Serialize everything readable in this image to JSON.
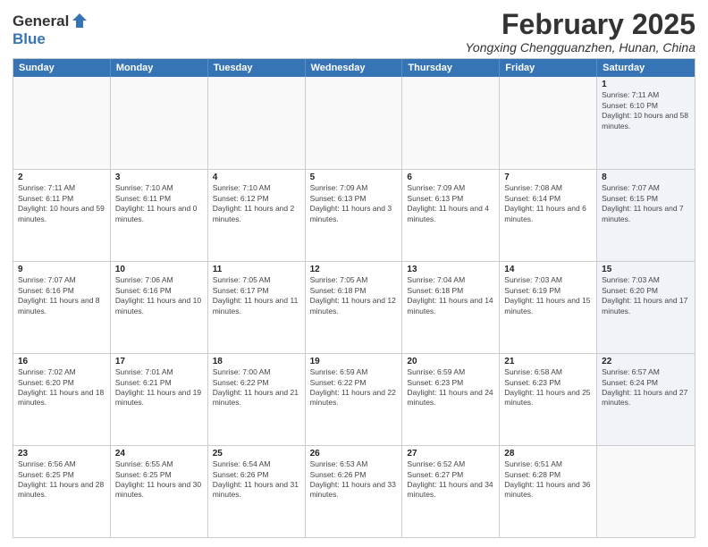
{
  "logo": {
    "general": "General",
    "blue": "Blue"
  },
  "title": "February 2025",
  "location": "Yongxing Chengguanzhen, Hunan, China",
  "weekdays": [
    "Sunday",
    "Monday",
    "Tuesday",
    "Wednesday",
    "Thursday",
    "Friday",
    "Saturday"
  ],
  "rows": [
    [
      {
        "day": "",
        "detail": ""
      },
      {
        "day": "",
        "detail": ""
      },
      {
        "day": "",
        "detail": ""
      },
      {
        "day": "",
        "detail": ""
      },
      {
        "day": "",
        "detail": ""
      },
      {
        "day": "",
        "detail": ""
      },
      {
        "day": "1",
        "detail": "Sunrise: 7:11 AM\nSunset: 6:10 PM\nDaylight: 10 hours and 58 minutes."
      }
    ],
    [
      {
        "day": "2",
        "detail": "Sunrise: 7:11 AM\nSunset: 6:11 PM\nDaylight: 10 hours and 59 minutes."
      },
      {
        "day": "3",
        "detail": "Sunrise: 7:10 AM\nSunset: 6:11 PM\nDaylight: 11 hours and 0 minutes."
      },
      {
        "day": "4",
        "detail": "Sunrise: 7:10 AM\nSunset: 6:12 PM\nDaylight: 11 hours and 2 minutes."
      },
      {
        "day": "5",
        "detail": "Sunrise: 7:09 AM\nSunset: 6:13 PM\nDaylight: 11 hours and 3 minutes."
      },
      {
        "day": "6",
        "detail": "Sunrise: 7:09 AM\nSunset: 6:13 PM\nDaylight: 11 hours and 4 minutes."
      },
      {
        "day": "7",
        "detail": "Sunrise: 7:08 AM\nSunset: 6:14 PM\nDaylight: 11 hours and 6 minutes."
      },
      {
        "day": "8",
        "detail": "Sunrise: 7:07 AM\nSunset: 6:15 PM\nDaylight: 11 hours and 7 minutes."
      }
    ],
    [
      {
        "day": "9",
        "detail": "Sunrise: 7:07 AM\nSunset: 6:16 PM\nDaylight: 11 hours and 8 minutes."
      },
      {
        "day": "10",
        "detail": "Sunrise: 7:06 AM\nSunset: 6:16 PM\nDaylight: 11 hours and 10 minutes."
      },
      {
        "day": "11",
        "detail": "Sunrise: 7:05 AM\nSunset: 6:17 PM\nDaylight: 11 hours and 11 minutes."
      },
      {
        "day": "12",
        "detail": "Sunrise: 7:05 AM\nSunset: 6:18 PM\nDaylight: 11 hours and 12 minutes."
      },
      {
        "day": "13",
        "detail": "Sunrise: 7:04 AM\nSunset: 6:18 PM\nDaylight: 11 hours and 14 minutes."
      },
      {
        "day": "14",
        "detail": "Sunrise: 7:03 AM\nSunset: 6:19 PM\nDaylight: 11 hours and 15 minutes."
      },
      {
        "day": "15",
        "detail": "Sunrise: 7:03 AM\nSunset: 6:20 PM\nDaylight: 11 hours and 17 minutes."
      }
    ],
    [
      {
        "day": "16",
        "detail": "Sunrise: 7:02 AM\nSunset: 6:20 PM\nDaylight: 11 hours and 18 minutes."
      },
      {
        "day": "17",
        "detail": "Sunrise: 7:01 AM\nSunset: 6:21 PM\nDaylight: 11 hours and 19 minutes."
      },
      {
        "day": "18",
        "detail": "Sunrise: 7:00 AM\nSunset: 6:22 PM\nDaylight: 11 hours and 21 minutes."
      },
      {
        "day": "19",
        "detail": "Sunrise: 6:59 AM\nSunset: 6:22 PM\nDaylight: 11 hours and 22 minutes."
      },
      {
        "day": "20",
        "detail": "Sunrise: 6:59 AM\nSunset: 6:23 PM\nDaylight: 11 hours and 24 minutes."
      },
      {
        "day": "21",
        "detail": "Sunrise: 6:58 AM\nSunset: 6:23 PM\nDaylight: 11 hours and 25 minutes."
      },
      {
        "day": "22",
        "detail": "Sunrise: 6:57 AM\nSunset: 6:24 PM\nDaylight: 11 hours and 27 minutes."
      }
    ],
    [
      {
        "day": "23",
        "detail": "Sunrise: 6:56 AM\nSunset: 6:25 PM\nDaylight: 11 hours and 28 minutes."
      },
      {
        "day": "24",
        "detail": "Sunrise: 6:55 AM\nSunset: 6:25 PM\nDaylight: 11 hours and 30 minutes."
      },
      {
        "day": "25",
        "detail": "Sunrise: 6:54 AM\nSunset: 6:26 PM\nDaylight: 11 hours and 31 minutes."
      },
      {
        "day": "26",
        "detail": "Sunrise: 6:53 AM\nSunset: 6:26 PM\nDaylight: 11 hours and 33 minutes."
      },
      {
        "day": "27",
        "detail": "Sunrise: 6:52 AM\nSunset: 6:27 PM\nDaylight: 11 hours and 34 minutes."
      },
      {
        "day": "28",
        "detail": "Sunrise: 6:51 AM\nSunset: 6:28 PM\nDaylight: 11 hours and 36 minutes."
      },
      {
        "day": "",
        "detail": ""
      }
    ]
  ]
}
